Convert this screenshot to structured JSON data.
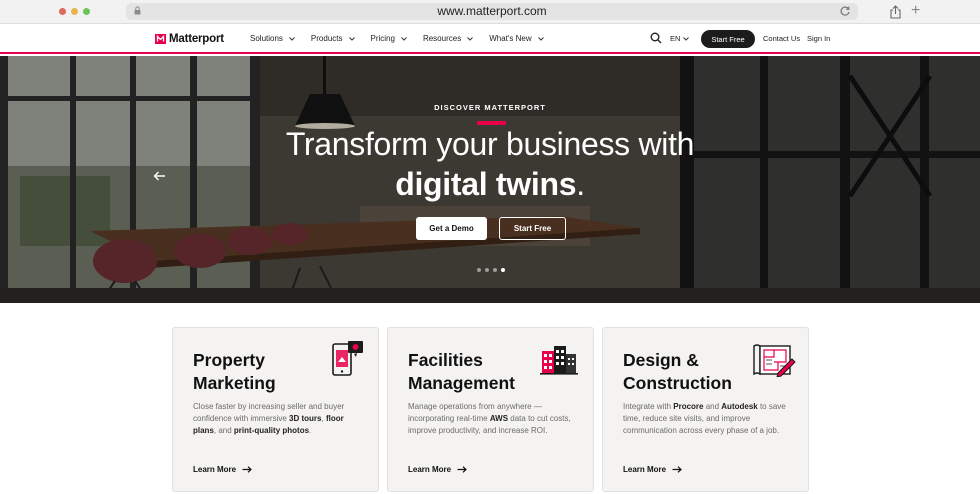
{
  "browser": {
    "url": "www.matterport.com",
    "traffic_lights": [
      "#e0675e",
      "#e8b24c",
      "#6dc459"
    ]
  },
  "nav": {
    "logo": "Matterport",
    "menu": [
      "Solutions",
      "Products",
      "Pricing",
      "Resources",
      "What's New"
    ],
    "lang": "EN",
    "start_free": "Start Free",
    "contact": "Contact Us",
    "sign_in": "Sign In",
    "accent": "#e8004a"
  },
  "hero": {
    "eyebrow": "DISCOVER MATTERPORT",
    "headline_line1": "Transform your business with",
    "headline_bold": "digital twins",
    "headline_end": ".",
    "cta_demo": "Get a Demo",
    "cta_free": "Start Free",
    "slides": 4,
    "active_slide": 4
  },
  "cards": [
    {
      "title": "Property Marketing",
      "icon": "property-marketing-icon",
      "desc_parts": [
        {
          "t": "Close faster by increasing seller and buyer confidence with immersive "
        },
        {
          "t": "3D tours",
          "b": true
        },
        {
          "t": ", "
        },
        {
          "t": "floor plans",
          "b": true
        },
        {
          "t": ", and "
        },
        {
          "t": "print-quality photos",
          "b": true
        },
        {
          "t": "."
        }
      ],
      "link": "Learn More"
    },
    {
      "title": "Facilities Management",
      "icon": "facilities-building-icon",
      "desc_parts": [
        {
          "t": "Manage operations from anywhere — incorporating real-time "
        },
        {
          "t": "AWS",
          "b": true
        },
        {
          "t": " data to cut costs, improve productivity, and increase ROI."
        }
      ],
      "link": "Learn More"
    },
    {
      "title": "Design & Construction",
      "icon": "blueprint-pencil-icon",
      "desc_parts": [
        {
          "t": "Integrate with "
        },
        {
          "t": "Procore",
          "b": true
        },
        {
          "t": " and "
        },
        {
          "t": "Autodesk",
          "b": true
        },
        {
          "t": " to save time, reduce site visits, and improve communication across every phase of a job."
        }
      ],
      "link": "Learn More"
    }
  ]
}
